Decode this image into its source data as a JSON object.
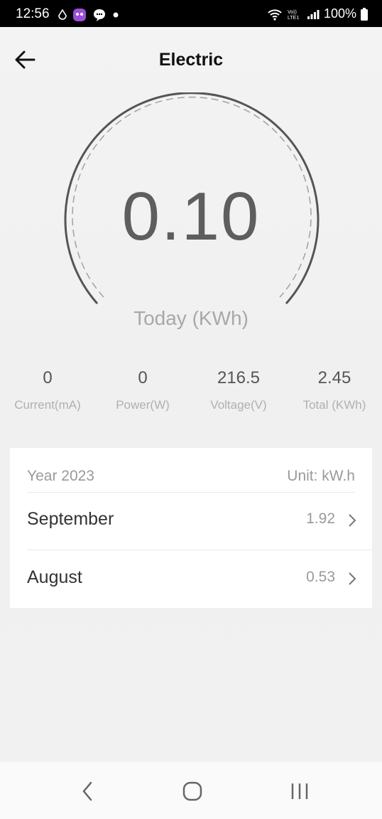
{
  "status_bar": {
    "time": "12:56",
    "battery": "100%",
    "icons_left": [
      "drop-icon",
      "app-icon",
      "chat-icon",
      "dot-icon"
    ],
    "icons_right": [
      "wifi-icon",
      "volte-icon",
      "signal-icon",
      "battery-icon"
    ]
  },
  "header": {
    "title": "Electric"
  },
  "gauge": {
    "value": "0.10",
    "label": "Today (KWh)"
  },
  "stats": [
    {
      "value": "0",
      "label": "Current(mA)"
    },
    {
      "value": "0",
      "label": "Power(W)"
    },
    {
      "value": "216.5",
      "label": "Voltage(V)"
    },
    {
      "value": "2.45",
      "label": "Total (KWh)"
    }
  ],
  "history": {
    "year_label": "Year 2023",
    "unit_label": "Unit: kW.h",
    "rows": [
      {
        "month": "September",
        "value": "1.92"
      },
      {
        "month": "August",
        "value": "0.53"
      }
    ]
  },
  "colors": {
    "gauge_arc": "#555555",
    "gauge_dash": "#a0a0a0",
    "value_text": "#5e5e5e"
  }
}
